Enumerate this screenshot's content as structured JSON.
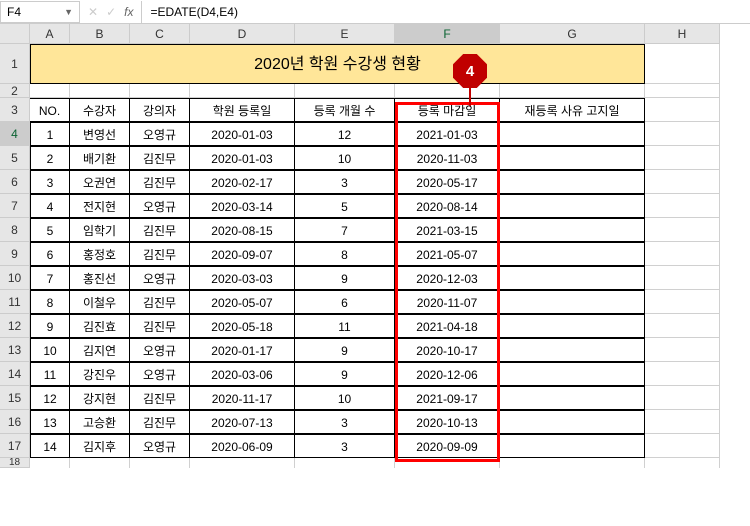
{
  "formula_bar": {
    "cell_ref": "F4",
    "formula": "=EDATE(D4,E4)"
  },
  "columns": [
    "A",
    "B",
    "C",
    "D",
    "E",
    "F",
    "G",
    "H"
  ],
  "title": "2020년 학원 수강생 현황",
  "callout": "4",
  "headers": {
    "no": "NO.",
    "student": "수강자",
    "instructor": "강의자",
    "reg_date": "학원 등록일",
    "months": "등록 개월 수",
    "end_date": "등록 마감일",
    "rereg": "재등록 사유 고지일"
  },
  "rows": [
    {
      "no": "1",
      "student": "변영선",
      "instructor": "오영규",
      "reg": "2020-01-03",
      "months": "12",
      "end": "2021-01-03"
    },
    {
      "no": "2",
      "student": "배기환",
      "instructor": "김진무",
      "reg": "2020-01-03",
      "months": "10",
      "end": "2020-11-03"
    },
    {
      "no": "3",
      "student": "오권연",
      "instructor": "김진무",
      "reg": "2020-02-17",
      "months": "3",
      "end": "2020-05-17"
    },
    {
      "no": "4",
      "student": "전지현",
      "instructor": "오영규",
      "reg": "2020-03-14",
      "months": "5",
      "end": "2020-08-14"
    },
    {
      "no": "5",
      "student": "임학기",
      "instructor": "김진무",
      "reg": "2020-08-15",
      "months": "7",
      "end": "2021-03-15"
    },
    {
      "no": "6",
      "student": "홍정호",
      "instructor": "김진무",
      "reg": "2020-09-07",
      "months": "8",
      "end": "2021-05-07"
    },
    {
      "no": "7",
      "student": "홍진선",
      "instructor": "오영규",
      "reg": "2020-03-03",
      "months": "9",
      "end": "2020-12-03"
    },
    {
      "no": "8",
      "student": "이철우",
      "instructor": "김진무",
      "reg": "2020-05-07",
      "months": "6",
      "end": "2020-11-07"
    },
    {
      "no": "9",
      "student": "김진효",
      "instructor": "김진무",
      "reg": "2020-05-18",
      "months": "11",
      "end": "2021-04-18"
    },
    {
      "no": "10",
      "student": "김지연",
      "instructor": "오영규",
      "reg": "2020-01-17",
      "months": "9",
      "end": "2020-10-17"
    },
    {
      "no": "11",
      "student": "강진우",
      "instructor": "오영규",
      "reg": "2020-03-06",
      "months": "9",
      "end": "2020-12-06"
    },
    {
      "no": "12",
      "student": "강지현",
      "instructor": "김진무",
      "reg": "2020-11-17",
      "months": "10",
      "end": "2021-09-17"
    },
    {
      "no": "13",
      "student": "고승환",
      "instructor": "김진무",
      "reg": "2020-07-13",
      "months": "3",
      "end": "2020-10-13"
    },
    {
      "no": "14",
      "student": "김지후",
      "instructor": "오영규",
      "reg": "2020-06-09",
      "months": "3",
      "end": "2020-09-09"
    }
  ],
  "row_numbers": [
    "1",
    "2",
    "3",
    "4",
    "5",
    "6",
    "7",
    "8",
    "9",
    "10",
    "11",
    "12",
    "13",
    "14",
    "15",
    "16",
    "17",
    "18"
  ]
}
